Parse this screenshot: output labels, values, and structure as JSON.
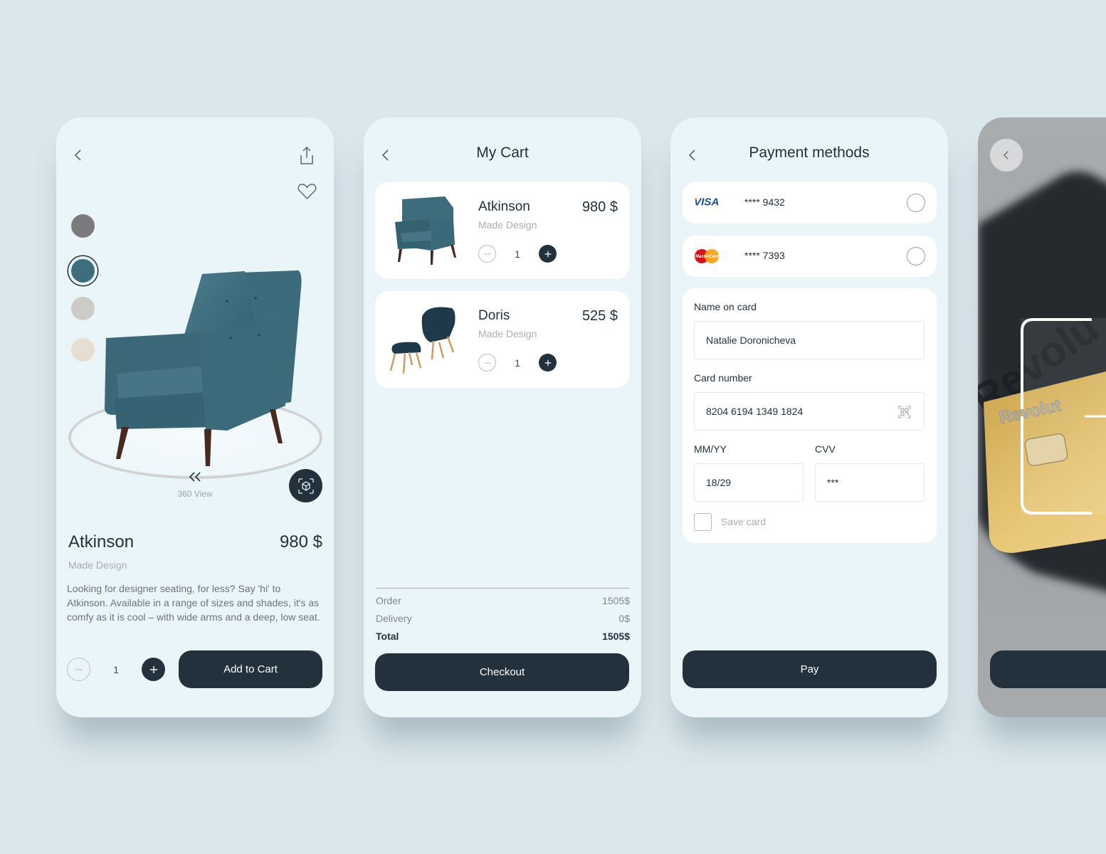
{
  "colors": {
    "background": "#dae7ed",
    "screen": "#eaf5fa",
    "primary_dark": "#22313c",
    "muted_text": "#a6adb1"
  },
  "product_screen": {
    "back_icon": "chevron-left",
    "share_icon": "share",
    "favorite_icon": "heart-outline",
    "swatches": [
      {
        "name": "grey",
        "color": "#7a7a7c",
        "selected": false
      },
      {
        "name": "teal",
        "color": "#3e6d7e",
        "selected": true
      },
      {
        "name": "light-grey",
        "color": "#cdcbc7",
        "selected": false
      },
      {
        "name": "cream",
        "color": "#e6ded0",
        "selected": false
      }
    ],
    "rotate_icon": "double-chevron-left",
    "view_label": "360 View",
    "ar_button_icon": "ar-cube",
    "name": "Atkinson",
    "price": "980 $",
    "brand": "Made Design",
    "description": "Looking for designer seating, for less? Say 'hi' to Atkinson. Available in a range of sizes and shades, it's as comfy as it is cool – with wide arms and a deep, low seat.",
    "quantity": "1",
    "add_to_cart_label": "Add to Cart"
  },
  "cart_screen": {
    "title": "My Cart",
    "items": [
      {
        "name": "Atkinson",
        "brand": "Made Design",
        "price": "980 $",
        "quantity": "1"
      },
      {
        "name": "Doris",
        "brand": "Made Design",
        "price": "525 $",
        "quantity": "1"
      }
    ],
    "summary": [
      {
        "label": "Order",
        "value": "1505$"
      },
      {
        "label": "Delivery",
        "value": "0$"
      },
      {
        "label": "Total",
        "value": "1505$"
      }
    ],
    "checkout_label": "Checkout"
  },
  "payment_screen": {
    "title": "Payment methods",
    "methods": [
      {
        "brand": "VISA",
        "number": "**** 9432",
        "selected": false
      },
      {
        "brand": "MasterCard",
        "number": "**** 7393",
        "selected": false
      }
    ],
    "form": {
      "name_label": "Name on card",
      "name_value": "Natalie Doronicheva",
      "number_label": "Card number",
      "number_value": "8204 6194 1349 1824",
      "expiry_label": "MM/YY",
      "expiry_value": "18/29",
      "cvv_label": "CVV",
      "cvv_value": "***",
      "save_card_label": "Save card",
      "save_card_checked": false
    },
    "pay_label": "Pay"
  },
  "scan_screen": {
    "card_brand_text": "Revolut",
    "back_icon": "chevron-left"
  }
}
